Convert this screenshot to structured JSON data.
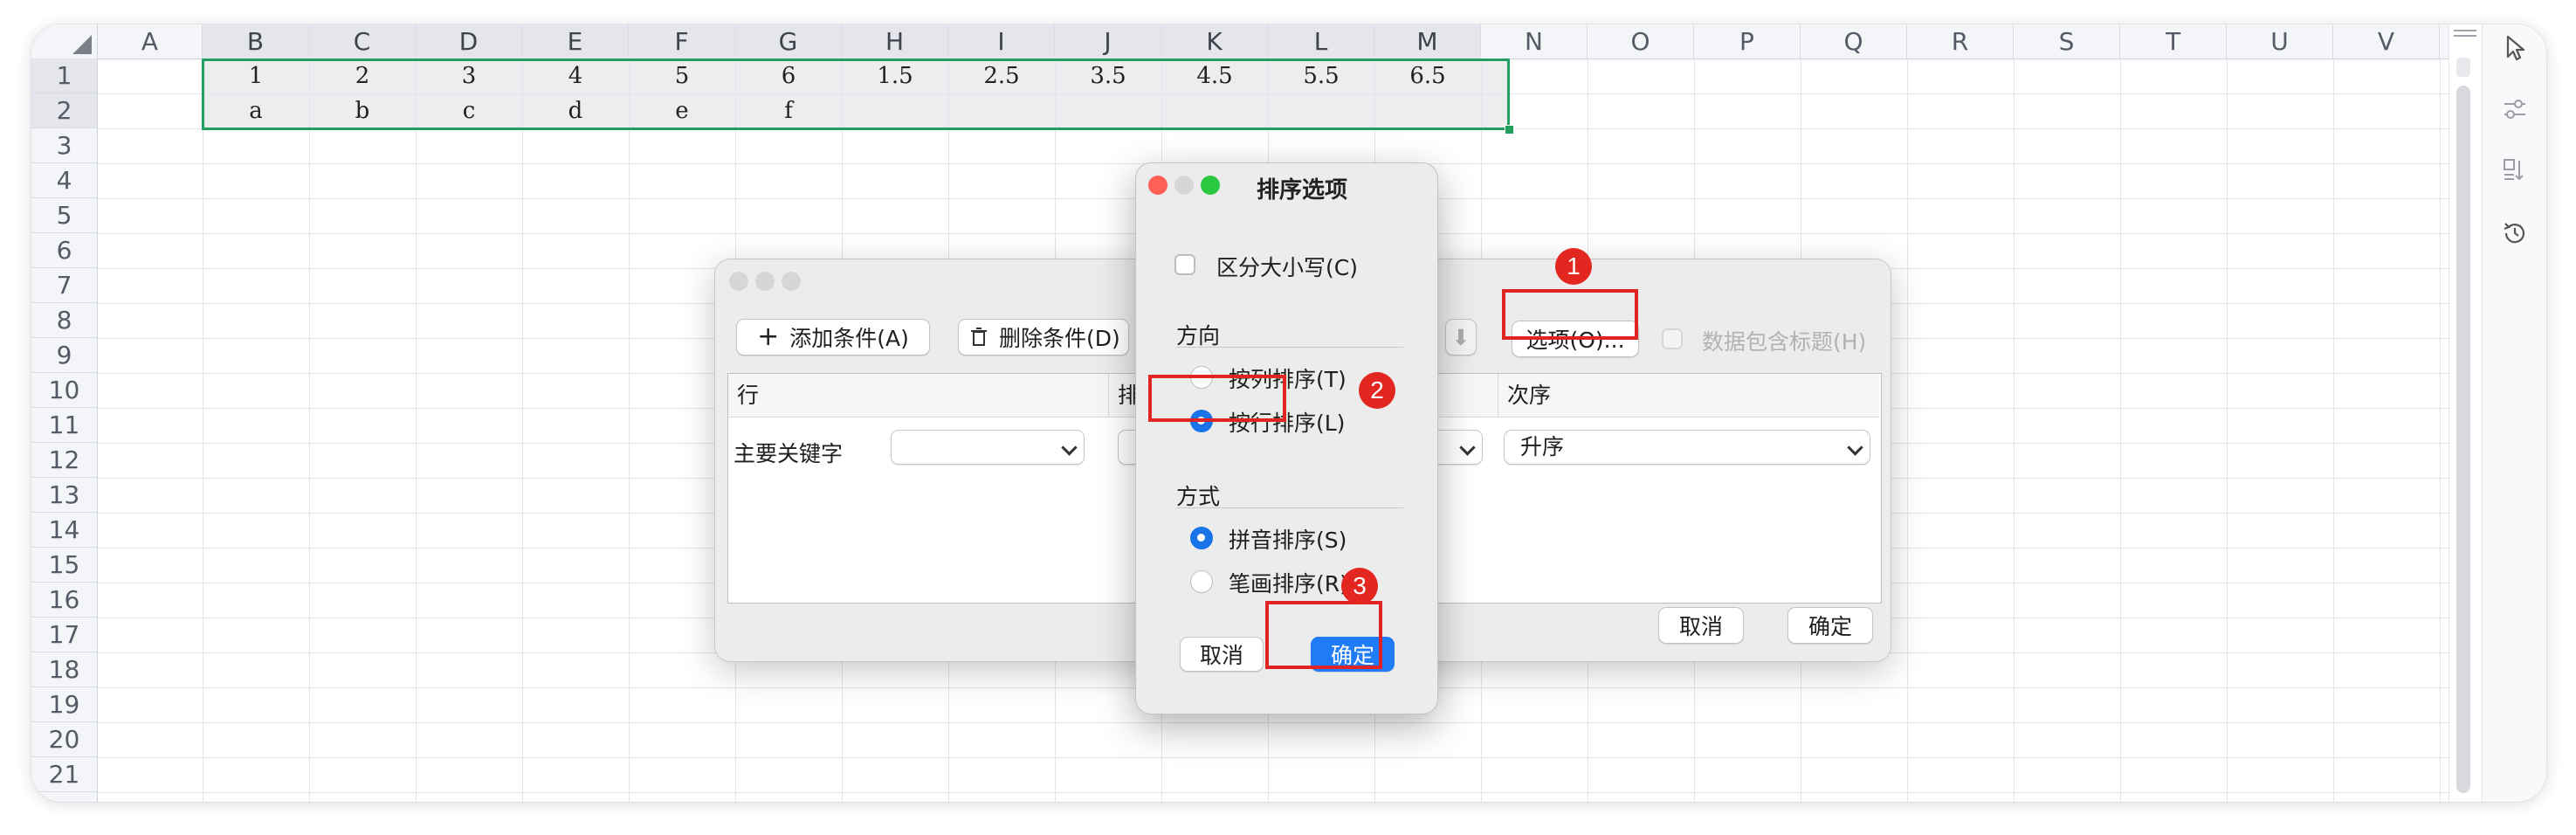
{
  "spreadsheet": {
    "columns": [
      "A",
      "B",
      "C",
      "D",
      "E",
      "F",
      "G",
      "H",
      "I",
      "J",
      "K",
      "L",
      "M",
      "N",
      "O",
      "P",
      "Q",
      "R",
      "S",
      "T",
      "U",
      "V"
    ],
    "rows": [
      "1",
      "2",
      "3",
      "4",
      "5",
      "6",
      "7",
      "8",
      "9",
      "10",
      "11",
      "12",
      "13",
      "14",
      "15",
      "16",
      "17",
      "18",
      "19",
      "20",
      "21"
    ],
    "row1": [
      "1",
      "2",
      "3",
      "4",
      "5",
      "6",
      "1.5",
      "2.5",
      "3.5",
      "4.5",
      "5.5",
      "6.5"
    ],
    "row2": [
      "a",
      "b",
      "c",
      "d",
      "e",
      "f"
    ],
    "selection_color": "#21a060"
  },
  "sort_dialog": {
    "add_condition": "添加条件(A)",
    "delete_condition": "删除条件(D)",
    "options_button": "选项(O)...",
    "has_header": "数据包含标题(H)",
    "col_row": "行",
    "col_sort": "排",
    "col_order": "次序",
    "primary_key": "主要关键字",
    "order_value": "升序",
    "cancel": "取消",
    "ok": "确定",
    "icons": [
      "plus-icon",
      "trash-icon",
      "move-down-icon",
      "chevron-down-icon"
    ]
  },
  "options_dialog": {
    "title": "排序选项",
    "case_sensitive": "区分大小写(C)",
    "direction_label": "方向",
    "by_column": "按列排序(T)",
    "by_row": "按行排序(L)",
    "method_label": "方式",
    "pinyin": "拼音排序(S)",
    "stroke": "笔画排序(R)",
    "cancel": "取消",
    "ok": "确定",
    "selected_direction": "by_row",
    "selected_method": "pinyin"
  },
  "annotations": [
    "1",
    "2",
    "3"
  ],
  "colors": {
    "accent": "#1f7cf6",
    "annotation_red": "#e02323",
    "traffic_close": "#fe5f57",
    "traffic_min": "#d6d6d6",
    "traffic_max": "#28c840"
  },
  "right_toolbar_icons": [
    "cursor-icon",
    "sliders-icon",
    "sort-icon",
    "history-icon"
  ]
}
